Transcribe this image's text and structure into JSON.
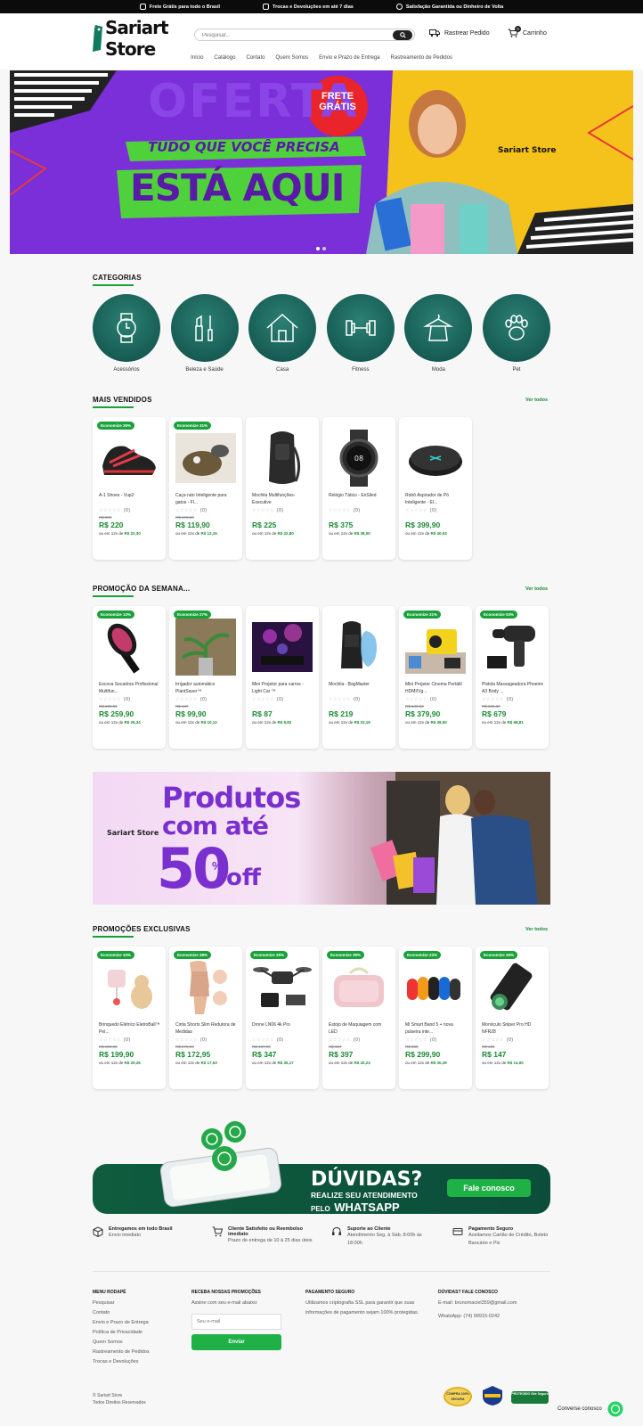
{
  "topbar": {
    "items": [
      "Frete Grátis para todo o Brasil",
      "Trocas e Devoluções em até 7 dias",
      "Satisfação Garantida ou Dinheiro de Volta"
    ]
  },
  "header": {
    "logo": "Sariart Store",
    "search_placeholder": "Pesquisar...",
    "track_label": "Rastrear Pedido",
    "cart_label": "Carrinho",
    "cart_count": "0"
  },
  "nav": [
    "Início",
    "Catálogo",
    "Contato",
    "Quem Somos",
    "Envio e Prazo de Entrega",
    "Rastreamento de Pedidos"
  ],
  "hero": {
    "bg_text": "OFERTA",
    "badge": "FRETE GRÁTIS",
    "line1": "TUDO QUE VOCÊ PRECISA",
    "line2": "ESTÁ AQUI",
    "logo": "Sariart Store"
  },
  "categories": {
    "title": "CATEGORIAS",
    "items": [
      {
        "label": "Acessórios",
        "icon": "watch-icon"
      },
      {
        "label": "Beleza e Saúde",
        "icon": "makeup-icon"
      },
      {
        "label": "Casa",
        "icon": "house-icon"
      },
      {
        "label": "Fitness",
        "icon": "dumbbell-icon"
      },
      {
        "label": "Moda",
        "icon": "shirt-icon"
      },
      {
        "label": "Pet",
        "icon": "paw-icon"
      }
    ]
  },
  "best": {
    "title": "MAIS VENDIDOS",
    "see_all": "Ver todos",
    "products": [
      {
        "badge": "Economize 26%",
        "name": "A-1 Shoes - Vup2",
        "reviews": "(0)",
        "old": "R$ 299",
        "price": "R$ 220",
        "inst_pre": "ou em 12x de ",
        "inst_val": "R$ 22,30"
      },
      {
        "badge": "Economize 31%",
        "name": "Caça rato Inteligente para gatos - Fl...",
        "reviews": "(0)",
        "old": "R$ 173,90",
        "price": "R$ 119,90",
        "inst_pre": "ou em 12x de ",
        "inst_val": "R$ 12,15"
      },
      {
        "badge": "",
        "name": "Mochila Multifunções- Executive",
        "reviews": "(0)",
        "old": "",
        "price": "R$ 225",
        "inst_pre": "ou em 12x de ",
        "inst_val": "R$ 22,80"
      },
      {
        "badge": "",
        "name": "Relógio Tático - EnSiled",
        "reviews": "(0)",
        "old": "",
        "price": "R$ 375",
        "inst_pre": "ou em 12x de ",
        "inst_val": "R$ 38,00"
      },
      {
        "badge": "",
        "name": "Robô Aspirador de Pó Inteligente - El...",
        "reviews": "(0)",
        "old": "",
        "price": "R$ 399,90",
        "inst_pre": "ou em 12x de ",
        "inst_val": "R$ 40,53"
      }
    ]
  },
  "weekly": {
    "title": "PROMOÇÃO DA SEMANA...",
    "see_all": "Ver todos",
    "products": [
      {
        "badge": "Economize 13%",
        "name": "Escova Secadora Profissional Multifun...",
        "reviews": "(0)",
        "old": "R$ 299,90",
        "price": "R$ 259,90",
        "inst_pre": "ou em 12x de ",
        "inst_val": "R$ 26,34"
      },
      {
        "badge": "Economize 27%",
        "name": "Irrigador automático PlantSaver™",
        "reviews": "(0)",
        "old": "R$ 137",
        "price": "R$ 99,90",
        "inst_pre": "ou em 12x de ",
        "inst_val": "R$ 10,12"
      },
      {
        "badge": "",
        "name": "Mini Projetor para carros - Light Car ™",
        "reviews": "(0)",
        "old": "",
        "price": "R$ 87",
        "inst_pre": "ou em 12x de ",
        "inst_val": "R$ 8,82"
      },
      {
        "badge": "",
        "name": "Mochila - BagMaster",
        "reviews": "(0)",
        "old": "",
        "price": "R$ 219",
        "inst_pre": "ou em 12x de ",
        "inst_val": "R$ 22,19"
      },
      {
        "badge": "Economize 31%",
        "name": "Mini Projetor Cinema Portátil HDMI/Vg...",
        "reviews": "(0)",
        "old": "R$ 549,90",
        "price": "R$ 379,90",
        "inst_pre": "ou em 12x de ",
        "inst_val": "R$ 38,50"
      },
      {
        "badge": "Economize 03%",
        "name": "Pistola Massageadora Phoenix A3 Body ...",
        "reviews": "(0)",
        "old": "R$ 699,90",
        "price": "R$ 679",
        "inst_pre": "ou em 12x de ",
        "inst_val": "R$ 68,81"
      }
    ]
  },
  "banner2": {
    "logo": "Sariart Store",
    "line1": "Produtos",
    "line2": "com até",
    "pct": "50",
    "pct_sym": "%",
    "off": "off"
  },
  "exclusive": {
    "title": "PROMOÇÕES EXCLUSIVAS",
    "see_all": "Ver todos",
    "products": [
      {
        "badge": "Economize 33%",
        "name": "Brinquedo Elétrico EletroBall™ Per...",
        "reviews": "(0)",
        "old": "R$ 299,90",
        "price": "R$ 199,90",
        "inst_pre": "ou em 12x de ",
        "inst_val": "R$ 20,26"
      },
      {
        "badge": "Economize 38%",
        "name": "Cinta Shorts Slim Redutora de Medidas",
        "reviews": "(0)",
        "old": "R$ 279,90",
        "price": "R$ 172,95",
        "inst_pre": "ou em 12x de ",
        "inst_val": "R$ 17,53"
      },
      {
        "badge": "Economize 30%",
        "name": "Drone LN06 4k Pro",
        "reviews": "(0)",
        "old": "R$ 497,90",
        "price": "R$ 347",
        "inst_pre": "ou em 12x de ",
        "inst_val": "R$ 35,17"
      },
      {
        "badge": "Economize 39%",
        "name": "Estojo de Maquiagem com LED",
        "reviews": "(0)",
        "old": "R$ 657",
        "price": "R$ 397",
        "inst_pre": "ou em 12x de ",
        "inst_val": "R$ 40,23"
      },
      {
        "badge": "Economize 23%",
        "name": "Mi Smart Band 5 + nova pulseira inte...",
        "reviews": "(0)",
        "old": "R$ 389",
        "price": "R$ 299,90",
        "inst_pre": "ou em 12x de ",
        "inst_val": "R$ 30,39"
      },
      {
        "badge": "Economize 26%",
        "name": "Monóculo Sniper Pro HD NFR28",
        "reviews": "(0)",
        "old": "R$ 199",
        "price": "R$ 147",
        "inst_pre": "ou em 12x de ",
        "inst_val": "R$ 14,90"
      }
    ]
  },
  "cta": {
    "title": "DÚVIDAS?",
    "sub1": "REALIZE SEU ATENDIMENTO",
    "sub2a": "PELO",
    "sub2b": "WHATSAPP",
    "button": "Fale conosco"
  },
  "features": [
    {
      "title": "Entregamos em todo Brasil",
      "sub": "Envio imediato"
    },
    {
      "title": "Cliente Satisfeito ou Reembolso imediato",
      "sub": "Prazo de entrega de 10 à 25 dias úteis"
    },
    {
      "title": "Suporte ao Cliente",
      "sub": "Atendimento Seg. à Sáb, 8:00h às 18:00h"
    },
    {
      "title": "Pagamento Seguro",
      "sub": "Aceitamos Cartão de Crédito, Boleto Bancário e Pix"
    }
  ],
  "footer": {
    "menu_title": "MENU RODAPÉ",
    "menu": [
      "Pesquisar",
      "Contato",
      "Envio e Prazo de Entrega",
      "Política de Privacidade",
      "Quem Somos",
      "Rastreamento de Pedidos",
      "Trocas e Devoluções"
    ],
    "news_title": "RECEBA NOSSAS PROMOÇÕES",
    "news_text": "Assine com seu e-mail abaixo:",
    "news_placeholder": "Seu e-mail",
    "news_button": "Enviar",
    "pay_title": "PAGAMENTO SEGURO",
    "pay_text": "Utilizamos criptografia SSL para garantir que suas informações de pagamento sejam 100% protegidas.",
    "help_title": "DÚVIDAS? FALE CONOSCO",
    "help_email": "E-mail: brunomaciel359@gmail.com",
    "help_whats": "WhatsApp: (74) 99915-0242",
    "copy1": "© Sariart Store",
    "copy2": "Todos Direitos Reservados",
    "seal1": "COMPRA 100% SEGURA",
    "seal3": "PROTEGIDO Site Seguro",
    "chat": "Converse conosco"
  }
}
